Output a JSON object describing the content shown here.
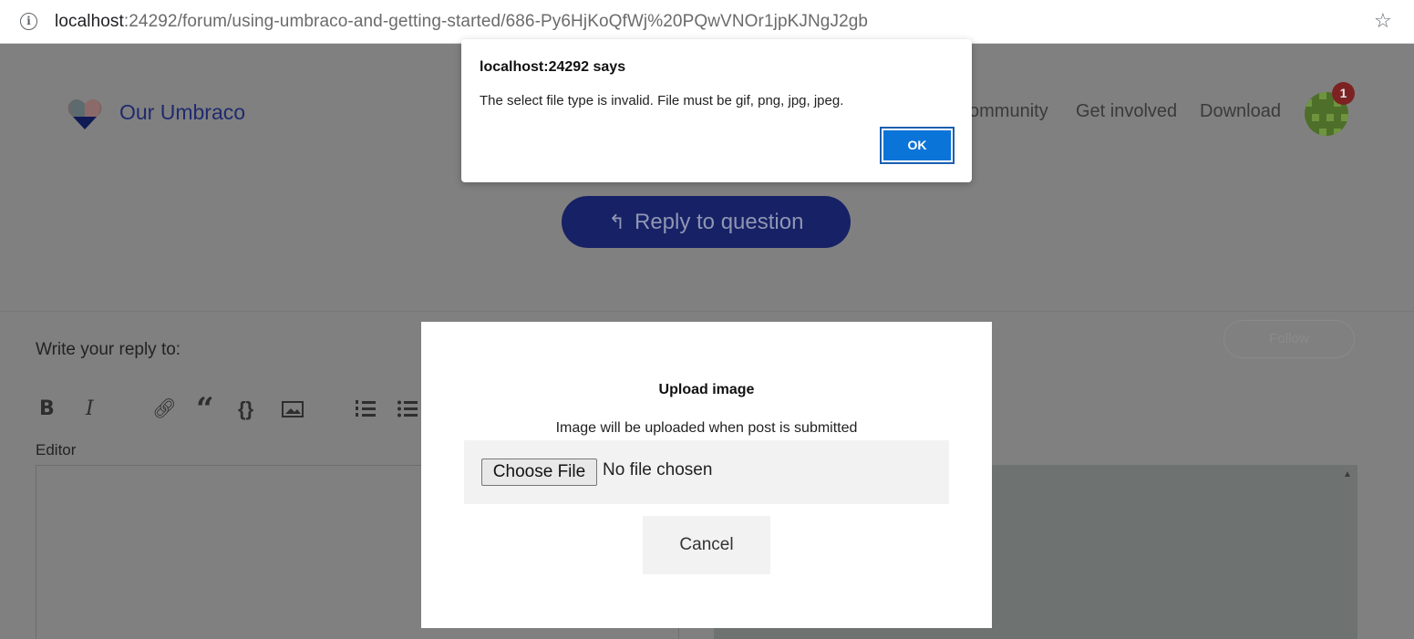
{
  "browser": {
    "url_host": "localhost",
    "url_rest": ":24292/forum/using-umbraco-and-getting-started/686-Py6HjKoQfWj%20PQwVNOr1jpKJNgJ2gb"
  },
  "header": {
    "brand": "Our Umbraco",
    "nav": [
      "ommunity",
      "Get involved",
      "Download"
    ],
    "notification_count": "1"
  },
  "reply_button": {
    "label": "Reply to question"
  },
  "follow_button": {
    "label": "Follow"
  },
  "reply_form": {
    "write_label": "Write your reply to:",
    "editor_label": "Editor",
    "toolbar": [
      "bold-icon",
      "italic-icon",
      "link-icon",
      "quote-icon",
      "code-icon",
      "image-icon",
      "ordered-list-icon",
      "bullet-list-icon"
    ]
  },
  "upload_modal": {
    "title": "Upload image",
    "subtitle": "Image will be uploaded when post is submitted",
    "choose_file": "Choose File",
    "no_file": "No file chosen",
    "cancel": "Cancel"
  },
  "alert": {
    "title": "localhost:24292 says",
    "message": "The select file type is invalid. File must be gif, png, jpg, jpeg.",
    "ok": "OK",
    "ok_color": "#0b74d8"
  }
}
